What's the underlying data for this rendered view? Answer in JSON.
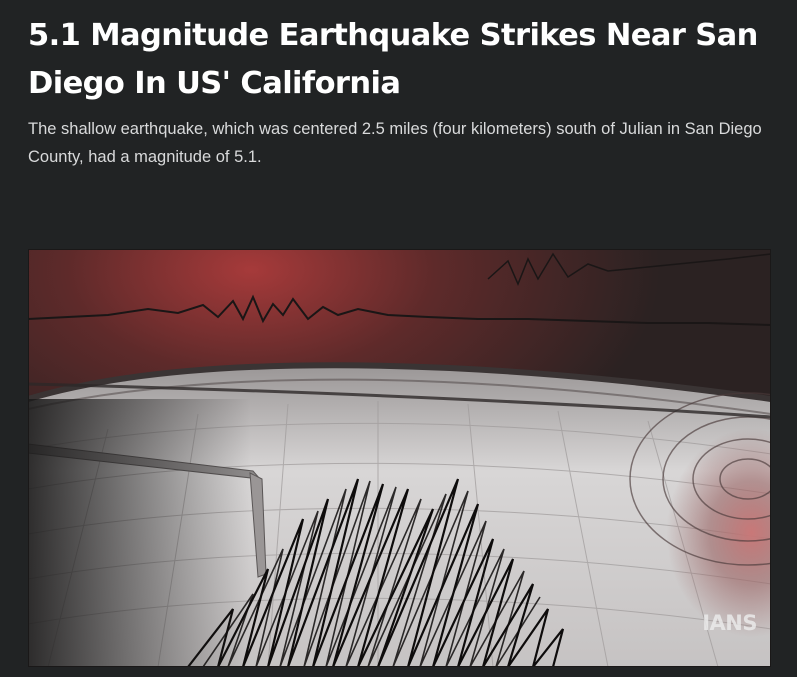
{
  "article": {
    "headline": "5.1 Magnitude Earthquake Strikes Near San Diego In US' California",
    "summary": "The shallow earthquake, which was centered 2.5 miles (four kilometers) south of Julian in San Diego County, had a magnitude of 5.1.",
    "image": {
      "credit": "IANS"
    }
  },
  "colors": {
    "page_background": "#212324",
    "headline": "#ffffff",
    "summary": "#d9dadb"
  }
}
